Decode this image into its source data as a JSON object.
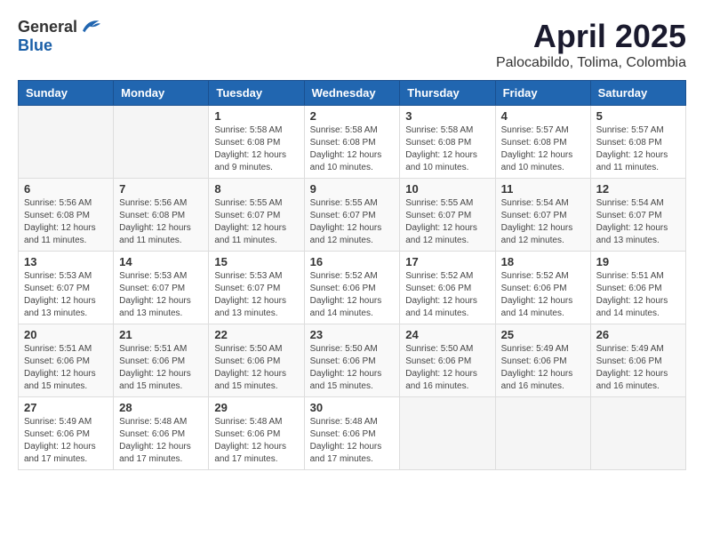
{
  "header": {
    "logo_general": "General",
    "logo_blue": "Blue",
    "month": "April 2025",
    "location": "Palocabildo, Tolima, Colombia"
  },
  "weekdays": [
    "Sunday",
    "Monday",
    "Tuesday",
    "Wednesday",
    "Thursday",
    "Friday",
    "Saturday"
  ],
  "weeks": [
    [
      {
        "day": "",
        "sunrise": "",
        "sunset": "",
        "daylight": ""
      },
      {
        "day": "",
        "sunrise": "",
        "sunset": "",
        "daylight": ""
      },
      {
        "day": "1",
        "sunrise": "Sunrise: 5:58 AM",
        "sunset": "Sunset: 6:08 PM",
        "daylight": "Daylight: 12 hours and 9 minutes."
      },
      {
        "day": "2",
        "sunrise": "Sunrise: 5:58 AM",
        "sunset": "Sunset: 6:08 PM",
        "daylight": "Daylight: 12 hours and 10 minutes."
      },
      {
        "day": "3",
        "sunrise": "Sunrise: 5:58 AM",
        "sunset": "Sunset: 6:08 PM",
        "daylight": "Daylight: 12 hours and 10 minutes."
      },
      {
        "day": "4",
        "sunrise": "Sunrise: 5:57 AM",
        "sunset": "Sunset: 6:08 PM",
        "daylight": "Daylight: 12 hours and 10 minutes."
      },
      {
        "day": "5",
        "sunrise": "Sunrise: 5:57 AM",
        "sunset": "Sunset: 6:08 PM",
        "daylight": "Daylight: 12 hours and 11 minutes."
      }
    ],
    [
      {
        "day": "6",
        "sunrise": "Sunrise: 5:56 AM",
        "sunset": "Sunset: 6:08 PM",
        "daylight": "Daylight: 12 hours and 11 minutes."
      },
      {
        "day": "7",
        "sunrise": "Sunrise: 5:56 AM",
        "sunset": "Sunset: 6:08 PM",
        "daylight": "Daylight: 12 hours and 11 minutes."
      },
      {
        "day": "8",
        "sunrise": "Sunrise: 5:55 AM",
        "sunset": "Sunset: 6:07 PM",
        "daylight": "Daylight: 12 hours and 11 minutes."
      },
      {
        "day": "9",
        "sunrise": "Sunrise: 5:55 AM",
        "sunset": "Sunset: 6:07 PM",
        "daylight": "Daylight: 12 hours and 12 minutes."
      },
      {
        "day": "10",
        "sunrise": "Sunrise: 5:55 AM",
        "sunset": "Sunset: 6:07 PM",
        "daylight": "Daylight: 12 hours and 12 minutes."
      },
      {
        "day": "11",
        "sunrise": "Sunrise: 5:54 AM",
        "sunset": "Sunset: 6:07 PM",
        "daylight": "Daylight: 12 hours and 12 minutes."
      },
      {
        "day": "12",
        "sunrise": "Sunrise: 5:54 AM",
        "sunset": "Sunset: 6:07 PM",
        "daylight": "Daylight: 12 hours and 13 minutes."
      }
    ],
    [
      {
        "day": "13",
        "sunrise": "Sunrise: 5:53 AM",
        "sunset": "Sunset: 6:07 PM",
        "daylight": "Daylight: 12 hours and 13 minutes."
      },
      {
        "day": "14",
        "sunrise": "Sunrise: 5:53 AM",
        "sunset": "Sunset: 6:07 PM",
        "daylight": "Daylight: 12 hours and 13 minutes."
      },
      {
        "day": "15",
        "sunrise": "Sunrise: 5:53 AM",
        "sunset": "Sunset: 6:07 PM",
        "daylight": "Daylight: 12 hours and 13 minutes."
      },
      {
        "day": "16",
        "sunrise": "Sunrise: 5:52 AM",
        "sunset": "Sunset: 6:06 PM",
        "daylight": "Daylight: 12 hours and 14 minutes."
      },
      {
        "day": "17",
        "sunrise": "Sunrise: 5:52 AM",
        "sunset": "Sunset: 6:06 PM",
        "daylight": "Daylight: 12 hours and 14 minutes."
      },
      {
        "day": "18",
        "sunrise": "Sunrise: 5:52 AM",
        "sunset": "Sunset: 6:06 PM",
        "daylight": "Daylight: 12 hours and 14 minutes."
      },
      {
        "day": "19",
        "sunrise": "Sunrise: 5:51 AM",
        "sunset": "Sunset: 6:06 PM",
        "daylight": "Daylight: 12 hours and 14 minutes."
      }
    ],
    [
      {
        "day": "20",
        "sunrise": "Sunrise: 5:51 AM",
        "sunset": "Sunset: 6:06 PM",
        "daylight": "Daylight: 12 hours and 15 minutes."
      },
      {
        "day": "21",
        "sunrise": "Sunrise: 5:51 AM",
        "sunset": "Sunset: 6:06 PM",
        "daylight": "Daylight: 12 hours and 15 minutes."
      },
      {
        "day": "22",
        "sunrise": "Sunrise: 5:50 AM",
        "sunset": "Sunset: 6:06 PM",
        "daylight": "Daylight: 12 hours and 15 minutes."
      },
      {
        "day": "23",
        "sunrise": "Sunrise: 5:50 AM",
        "sunset": "Sunset: 6:06 PM",
        "daylight": "Daylight: 12 hours and 15 minutes."
      },
      {
        "day": "24",
        "sunrise": "Sunrise: 5:50 AM",
        "sunset": "Sunset: 6:06 PM",
        "daylight": "Daylight: 12 hours and 16 minutes."
      },
      {
        "day": "25",
        "sunrise": "Sunrise: 5:49 AM",
        "sunset": "Sunset: 6:06 PM",
        "daylight": "Daylight: 12 hours and 16 minutes."
      },
      {
        "day": "26",
        "sunrise": "Sunrise: 5:49 AM",
        "sunset": "Sunset: 6:06 PM",
        "daylight": "Daylight: 12 hours and 16 minutes."
      }
    ],
    [
      {
        "day": "27",
        "sunrise": "Sunrise: 5:49 AM",
        "sunset": "Sunset: 6:06 PM",
        "daylight": "Daylight: 12 hours and 17 minutes."
      },
      {
        "day": "28",
        "sunrise": "Sunrise: 5:48 AM",
        "sunset": "Sunset: 6:06 PM",
        "daylight": "Daylight: 12 hours and 17 minutes."
      },
      {
        "day": "29",
        "sunrise": "Sunrise: 5:48 AM",
        "sunset": "Sunset: 6:06 PM",
        "daylight": "Daylight: 12 hours and 17 minutes."
      },
      {
        "day": "30",
        "sunrise": "Sunrise: 5:48 AM",
        "sunset": "Sunset: 6:06 PM",
        "daylight": "Daylight: 12 hours and 17 minutes."
      },
      {
        "day": "",
        "sunrise": "",
        "sunset": "",
        "daylight": ""
      },
      {
        "day": "",
        "sunrise": "",
        "sunset": "",
        "daylight": ""
      },
      {
        "day": "",
        "sunrise": "",
        "sunset": "",
        "daylight": ""
      }
    ]
  ]
}
